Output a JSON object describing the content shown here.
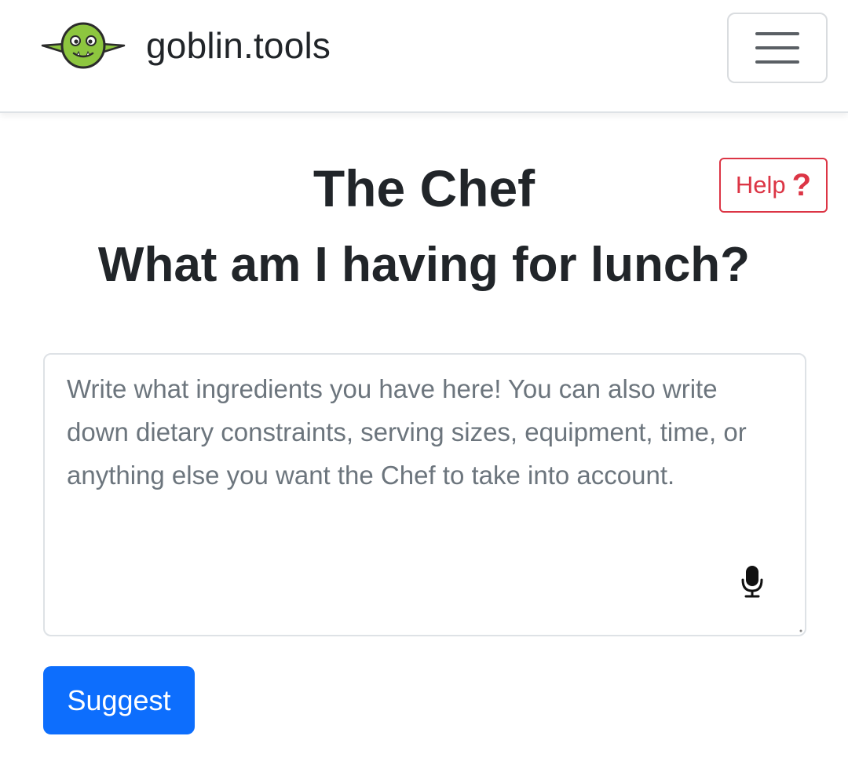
{
  "navbar": {
    "brand_text": "goblin.tools",
    "logo_icon": "goblin-face-icon",
    "menu_icon": "hamburger-menu-icon"
  },
  "help": {
    "label": "Help",
    "icon": "question-mark-icon",
    "icon_glyph": "?"
  },
  "page": {
    "title": "The Chef",
    "subtitle": "What am I having for lunch?"
  },
  "ingredients_input": {
    "placeholder": "Write what ingredients you have here! You can also write down dietary constraints, serving sizes, equipment, time, or anything else you want the Chef to take into account.",
    "value": "",
    "mic_icon": "microphone-icon"
  },
  "actions": {
    "suggest_label": "Suggest"
  },
  "colors": {
    "primary": "#0d6efd",
    "danger": "#dc3545",
    "logo_green": "#8dc63f",
    "text": "#212529",
    "placeholder": "#6c757d"
  }
}
